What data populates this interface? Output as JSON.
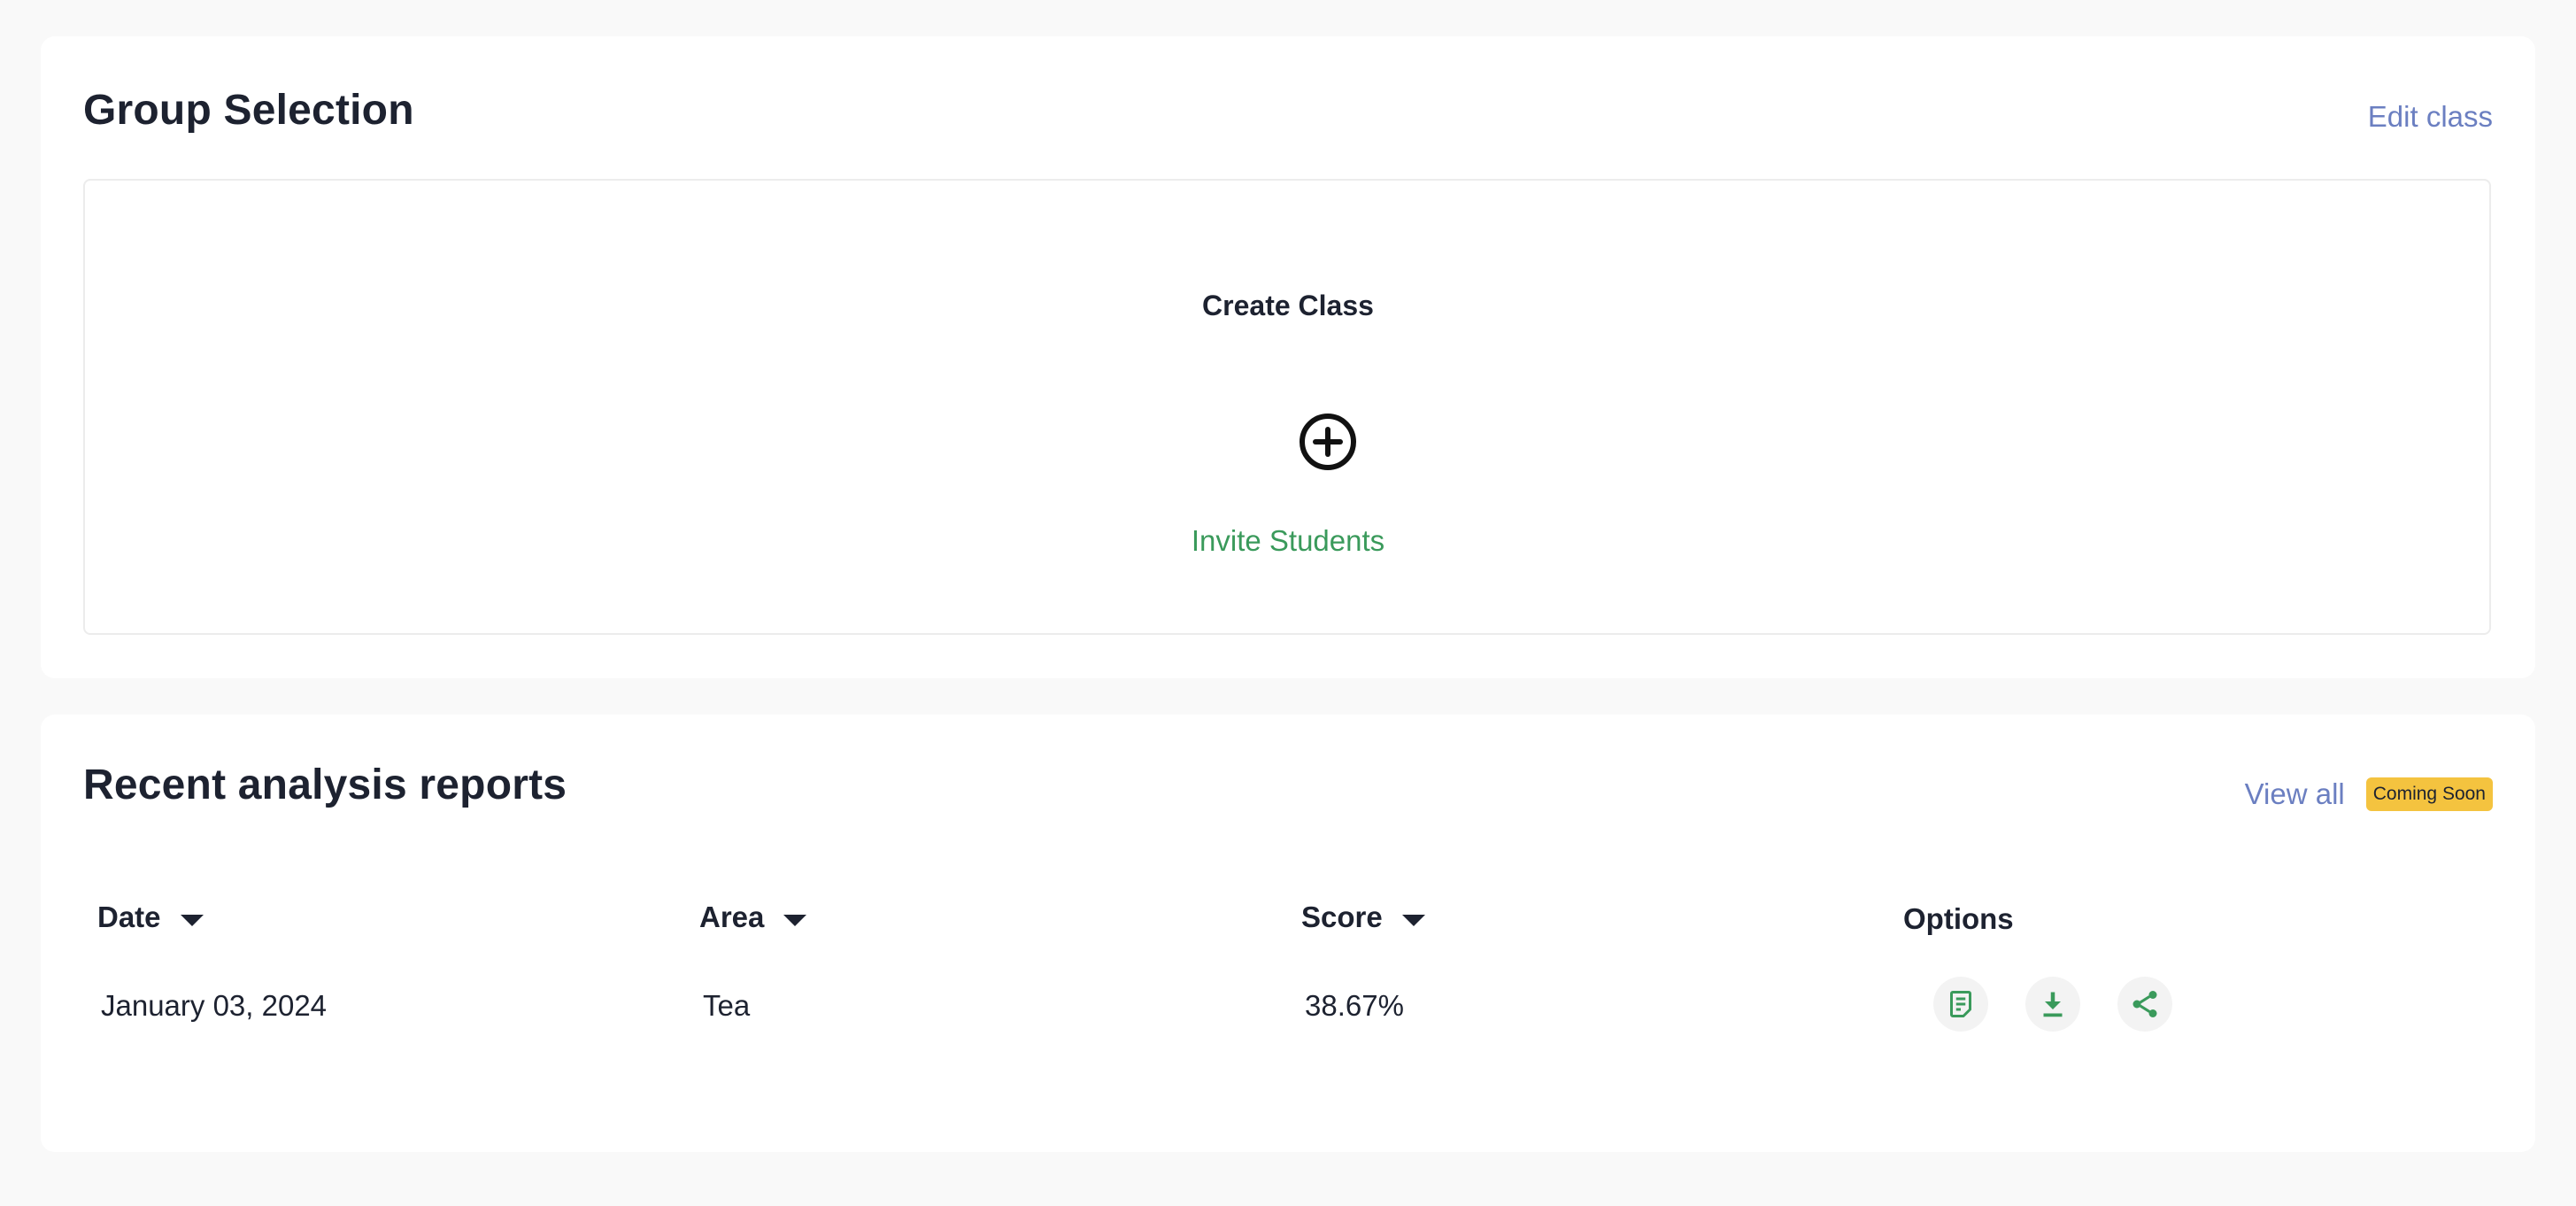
{
  "group": {
    "title": "Group Selection",
    "edit_link": "Edit class",
    "create_title": "Create Class",
    "invite_link": "Invite Students"
  },
  "reports": {
    "title": "Recent analysis reports",
    "view_all": "View all",
    "badge": "Coming Soon",
    "columns": [
      "Date",
      "Area",
      "Score",
      "Options"
    ],
    "rows": [
      {
        "date": "January 03, 2024",
        "area": "Tea",
        "score": "38.67%"
      }
    ],
    "option_icons": [
      "report-icon",
      "download-icon",
      "share-icon"
    ]
  },
  "colors": {
    "link": "#6b7fc1",
    "accent_green": "#3a9a5b",
    "badge": "#f4c33f",
    "text": "#1d2230"
  }
}
